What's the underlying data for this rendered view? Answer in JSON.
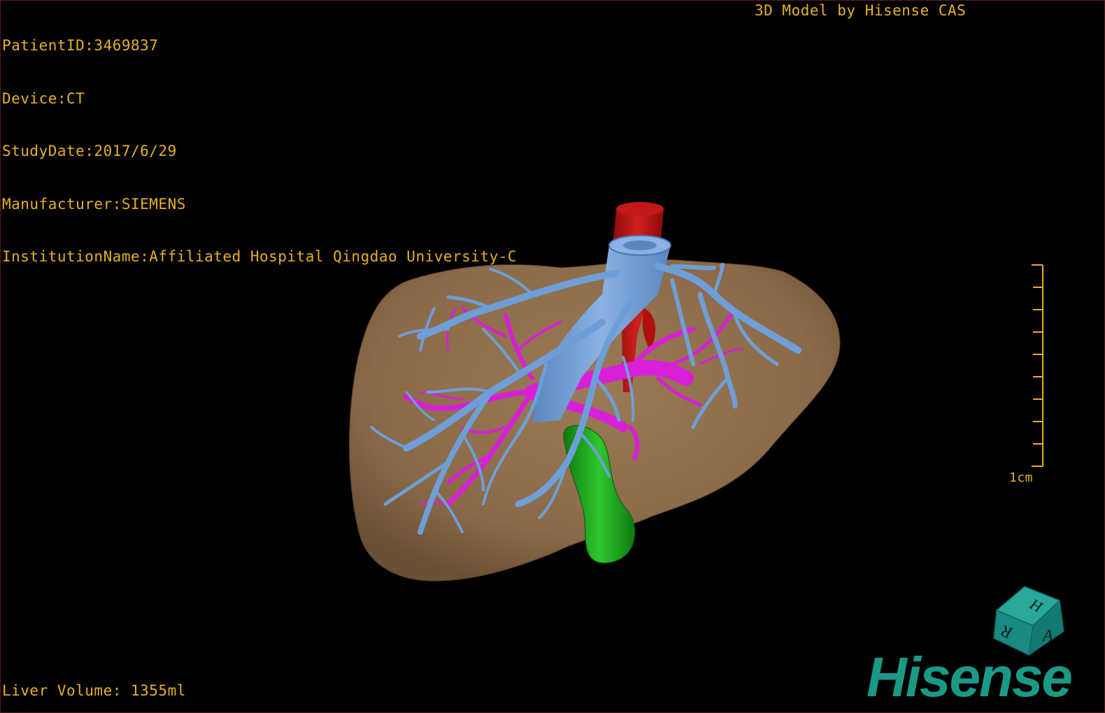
{
  "patient": {
    "patient_id": "PatientID:3469837",
    "device": "Device:CT",
    "study_date": "StudyDate:2017/6/29",
    "manufacturer": "Manufacturer:SIEMENS",
    "institution": "InstitutionName:Affiliated Hospital Qingdao University-C"
  },
  "brand_caption": "3D Model by Hisense CAS",
  "liver_volume": "Liver Volume: 1355ml",
  "scale_bar": {
    "label": "1cm"
  },
  "logo": {
    "text": "Hisense"
  },
  "orientation_cube": {
    "faces": [
      "H",
      "R",
      "A"
    ],
    "color": "#1a8a80"
  },
  "colors": {
    "overlay_text": "#e8b020",
    "liver": "#8b6a48",
    "hepatic_vein": "#6a9ad4",
    "portal_vein": "#d020d0",
    "aorta": "#b01010",
    "gallbladder_duct": "#1aa01a",
    "logo": "#1a9a86"
  },
  "model_parts": {
    "liver": "liver-surface",
    "hepatic_veins": "hepatic-vein-tree",
    "portal_veins": "portal-vein-tree",
    "inferior_vena_cava": "inferior-vena-cava",
    "aorta": "aorta-segment",
    "green_structure": "green-tubular-structure"
  }
}
